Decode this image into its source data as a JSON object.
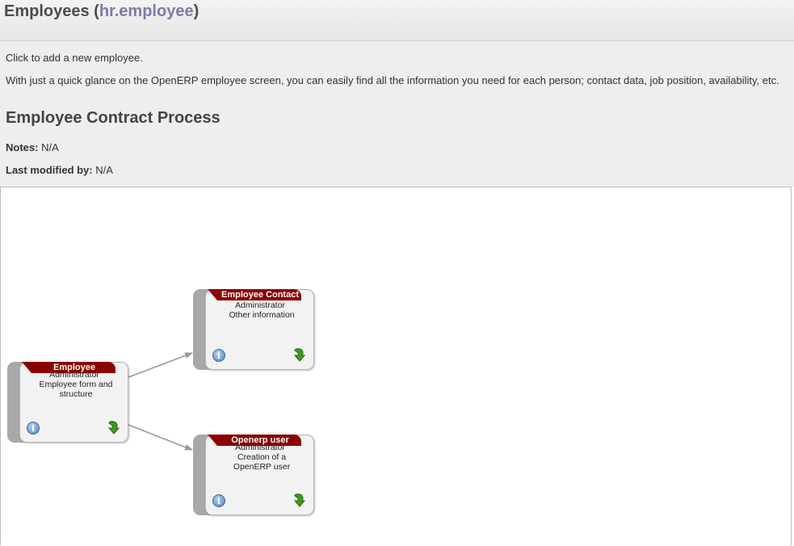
{
  "header": {
    "title": "Employees",
    "paren_open": "(",
    "model": "hr.employee",
    "paren_close": ")"
  },
  "info": {
    "line1": "Click to add a new employee.",
    "line2": "With just a quick glance on the OpenERP employee screen, you can easily find all the information you need for each person; contact data, job position, availability, etc.",
    "process_title": "Employee Contract Process",
    "notes_label": "Notes:",
    "notes_value": "N/A",
    "modified_label": "Last modified by:",
    "modified_value": "N/A"
  },
  "nodes": [
    {
      "title": "Employee",
      "role": "Administrator",
      "desc": "Employee form and structure"
    },
    {
      "title": "Employee Contact",
      "role": "Administrator",
      "desc": "Other information"
    },
    {
      "title": "Openerp user",
      "role": "Administrator",
      "desc": "Creation of a OpenERP user"
    }
  ],
  "icons": {
    "info": "info-icon",
    "go": "green-arrow-icon",
    "info_glyph": "i"
  },
  "colors": {
    "node_title_bg": "#8b0000",
    "model_link": "#7c7bad",
    "go_arrow": "#3c9a1e"
  }
}
